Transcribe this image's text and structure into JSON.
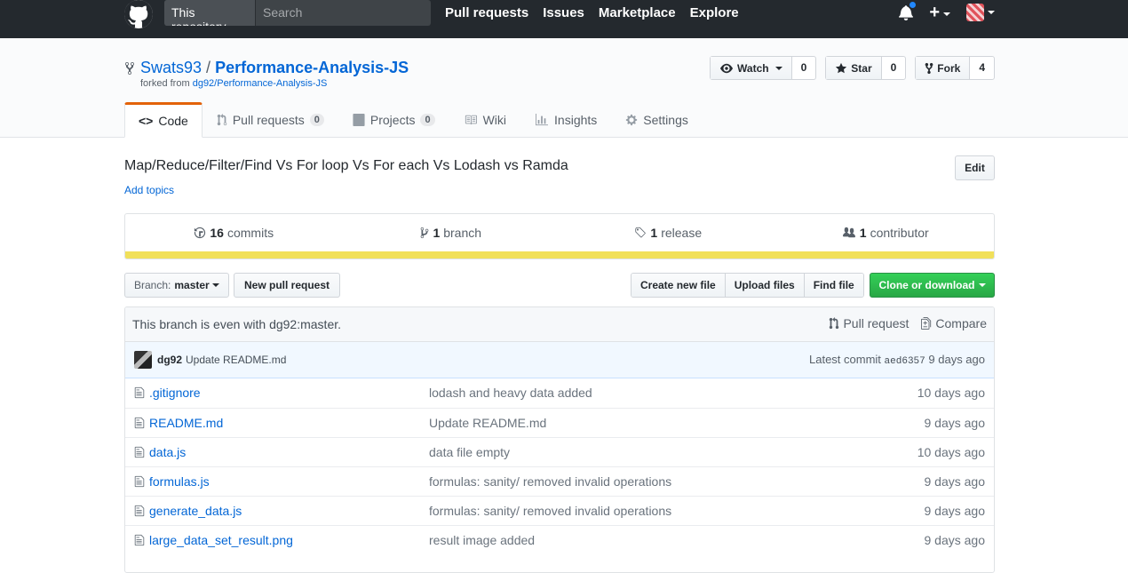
{
  "header": {
    "search_scope": "This repository",
    "search_placeholder": "Search",
    "nav": [
      "Pull requests",
      "Issues",
      "Marketplace",
      "Explore"
    ]
  },
  "repo": {
    "owner": "Swats93",
    "separator": "/",
    "name": "Performance-Analysis-JS",
    "forked_prefix": "forked from",
    "forked_source": "dg92/Performance-Analysis-JS"
  },
  "actions": {
    "watch_label": "Watch",
    "watch_count": "0",
    "star_label": "Star",
    "star_count": "0",
    "fork_label": "Fork",
    "fork_count": "4"
  },
  "tabs": [
    {
      "label": "Code",
      "count": null
    },
    {
      "label": "Pull requests",
      "count": "0"
    },
    {
      "label": "Projects",
      "count": "0"
    },
    {
      "label": "Wiki",
      "count": null
    },
    {
      "label": "Insights",
      "count": null
    },
    {
      "label": "Settings",
      "count": null
    }
  ],
  "description": "Map/Reduce/Filter/Find Vs For loop Vs For each Vs Lodash vs Ramda",
  "add_topics": "Add topics",
  "edit_label": "Edit",
  "summary": {
    "commits_num": "16",
    "commits_label": "commits",
    "branch_num": "1",
    "branch_label": "branch",
    "release_num": "1",
    "release_label": "release",
    "contributor_num": "1",
    "contributor_label": "contributor",
    "language_color": "#f1e05a"
  },
  "filenav": {
    "branch_prefix": "Branch:",
    "branch_name": "master",
    "new_pr": "New pull request",
    "create_file": "Create new file",
    "upload_files": "Upload files",
    "find_file": "Find file",
    "clone": "Clone or download"
  },
  "branch_status": {
    "text": "This branch is even with dg92:master.",
    "pull_request": "Pull request",
    "compare": "Compare"
  },
  "latest_commit": {
    "author": "dg92",
    "message": "Update README.md",
    "prefix": "Latest commit",
    "sha": "aed6357",
    "age": "9 days ago"
  },
  "files": [
    {
      "name": ".gitignore",
      "message": "lodash and heavy data added",
      "age": "10 days ago"
    },
    {
      "name": "README.md",
      "message": "Update README.md",
      "age": "9 days ago"
    },
    {
      "name": "data.js",
      "message": "data file empty",
      "age": "10 days ago"
    },
    {
      "name": "formulas.js",
      "message": "formulas: sanity/ removed invalid operations",
      "age": "9 days ago"
    },
    {
      "name": "generate_data.js",
      "message": "formulas: sanity/ removed invalid operations",
      "age": "9 days ago"
    },
    {
      "name": "large_data_set_result.png",
      "message": "result image added",
      "age": "9 days ago"
    }
  ]
}
